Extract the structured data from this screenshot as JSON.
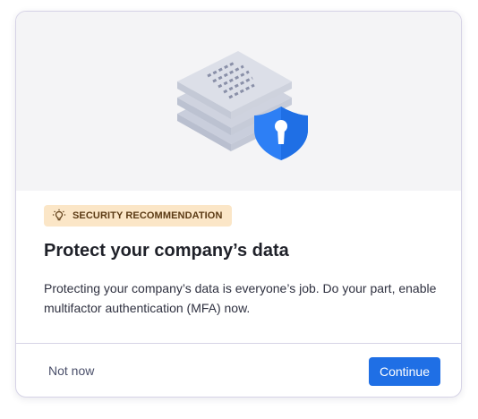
{
  "illustration": {
    "icon": "documents-shield-lock-icon",
    "colors": {
      "background": "#f4f4f6",
      "paper": "#d8dbe6",
      "paper_shadow": "#c4c9d8",
      "lines": "#8a90a8",
      "shield": "#1f6fe5"
    }
  },
  "badge": {
    "icon": "lightbulb-icon",
    "label": "SECURITY RECOMMENDATION",
    "background": "#fbe6c7"
  },
  "title": "Protect your company’s data",
  "description": "Protecting your company’s data is everyone’s job. Do your part, enable multifactor authentication (MFA) now.",
  "actions": {
    "secondary_label": "Not now",
    "primary_label": "Continue",
    "primary_color": "#1f6fe5"
  }
}
